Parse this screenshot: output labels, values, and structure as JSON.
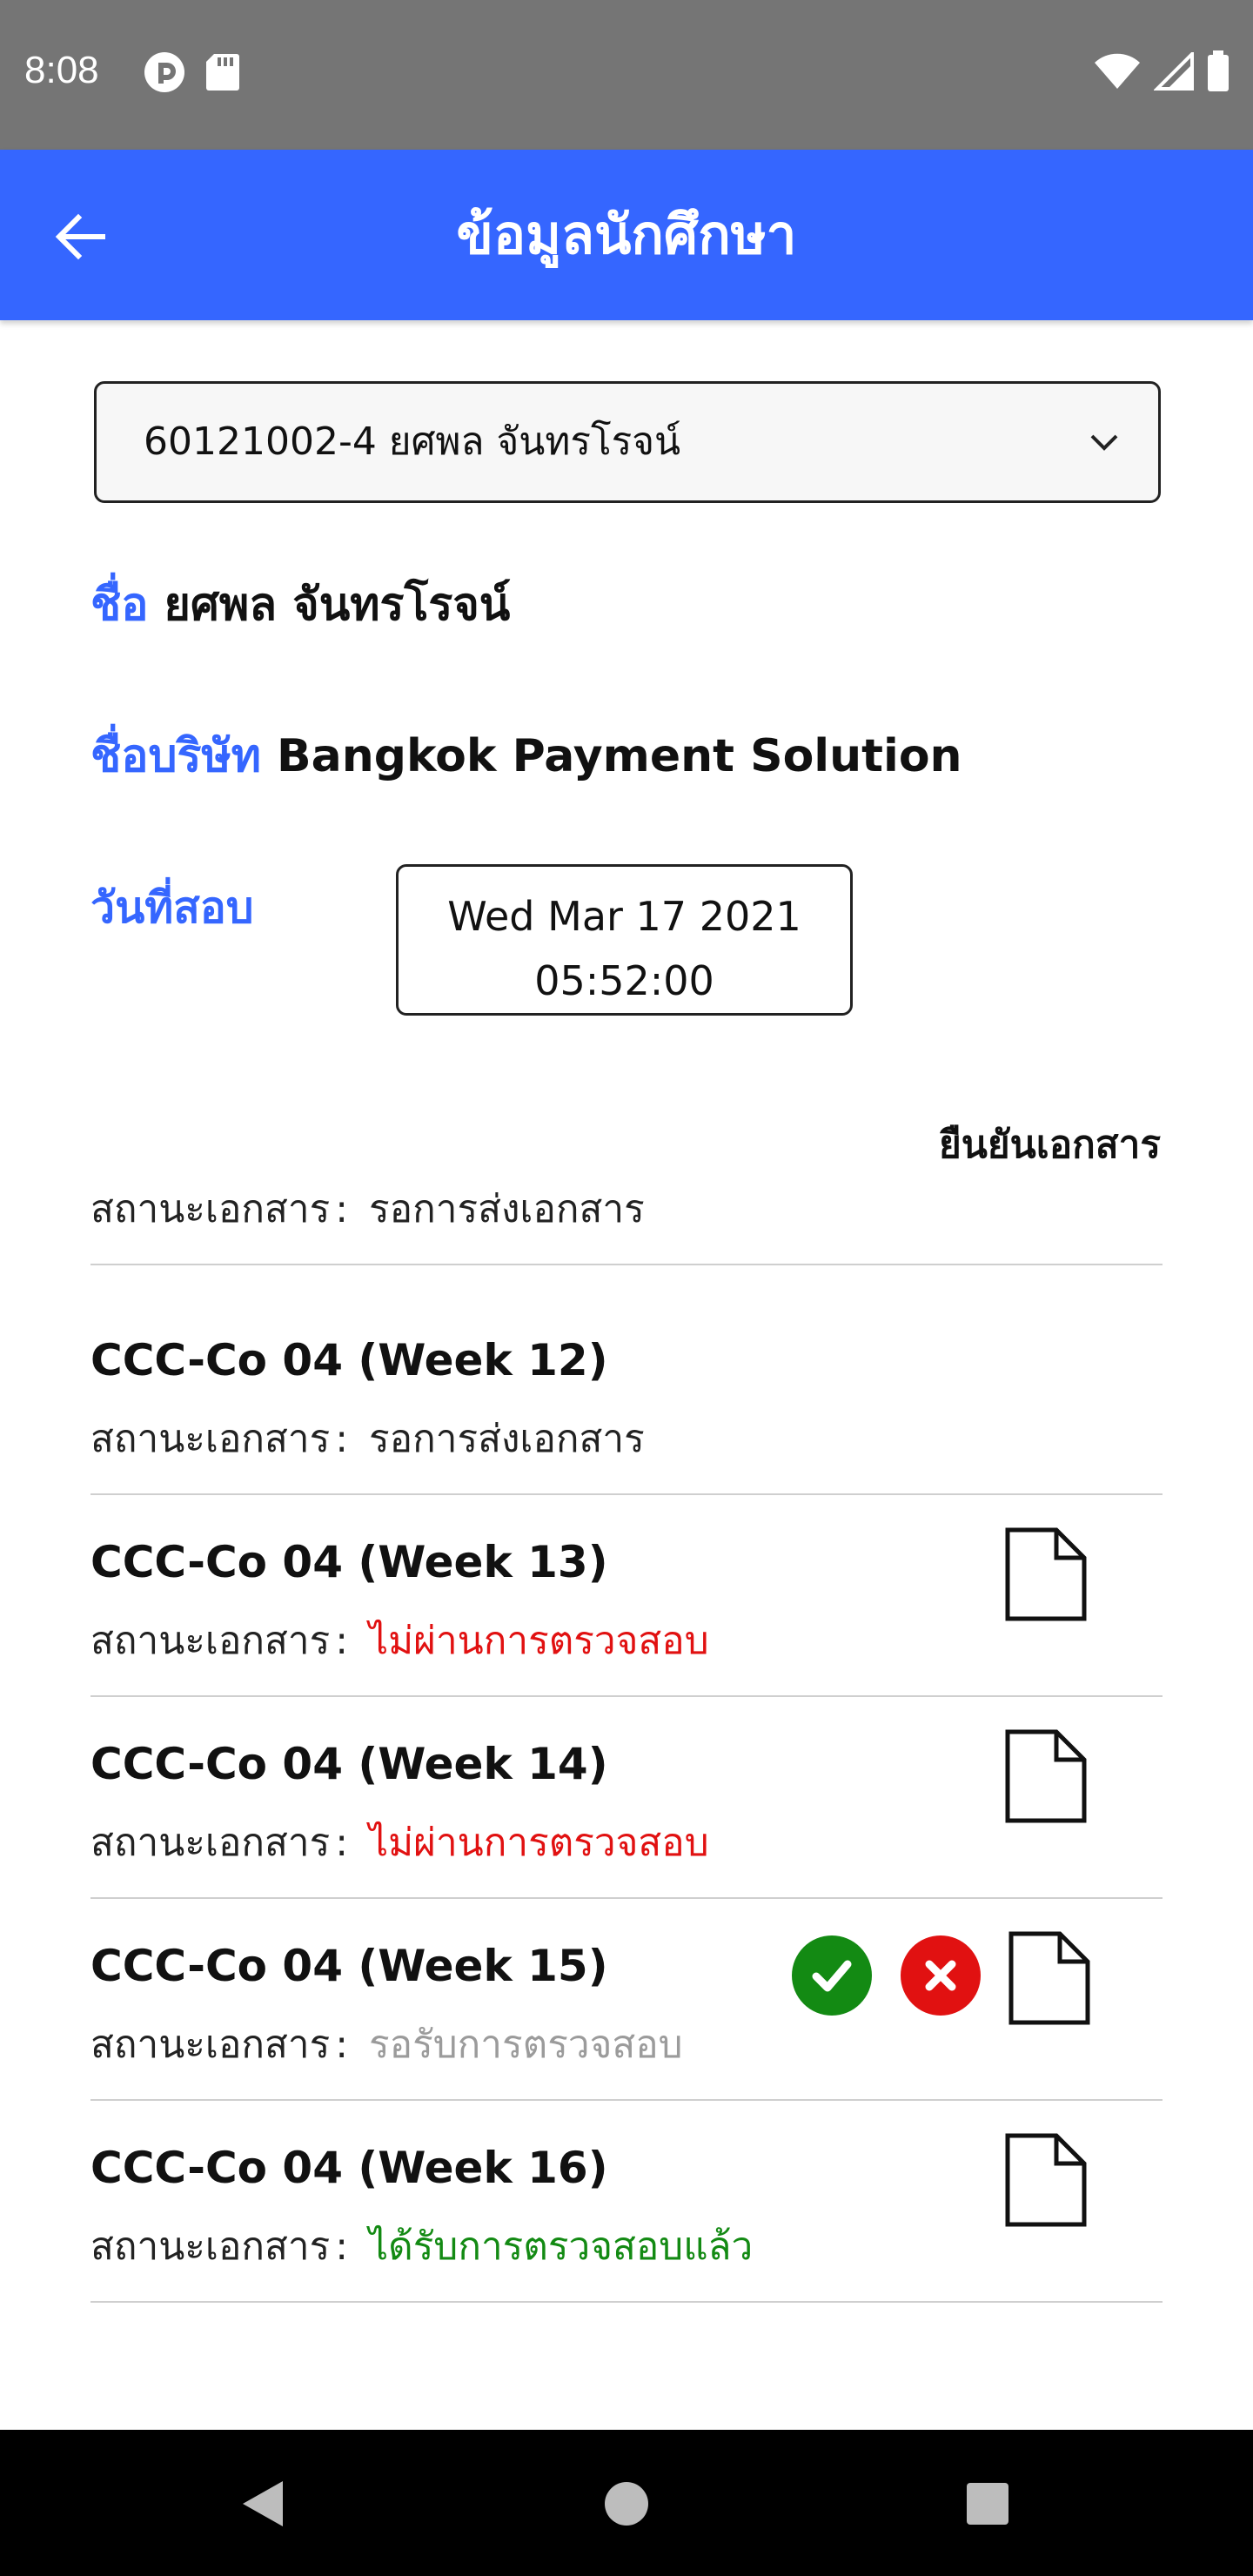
{
  "status_bar": {
    "time": "8:08",
    "icons": [
      "pocket-casts-icon",
      "sd-card-icon",
      "wifi-icon",
      "signal-icon",
      "battery-icon"
    ]
  },
  "app_bar": {
    "title": "ข้อมูลนักศึกษา",
    "back_icon": "arrow-left-icon",
    "color": "#3566ff"
  },
  "student_select": {
    "value": "60121002-4 ยศพล จันทรโรจน์"
  },
  "info": {
    "name_label": "ชื่อ",
    "name_value": "ยศพล จันทรโรจน์",
    "company_label": "ชื่อบริษัท",
    "company_value": "Bangkok Payment Solution",
    "exam_label": "วันที่สอบ",
    "exam_date": "Wed Mar 17 2021",
    "exam_time": "05:52:00"
  },
  "confirm_doc_label": "ยืนยันเอกสาร",
  "documents": [
    {
      "title": "",
      "status_label": "สถานะเอกสาร",
      "status": "รอการส่งเอกสาร",
      "status_type": "wait"
    },
    {
      "title": "CCC-Co 04 (Week 12)",
      "status_label": "สถานะเอกสาร",
      "status": "รอการส่งเอกสาร",
      "status_type": "wait"
    },
    {
      "title": "CCC-Co 04 (Week 13)",
      "status_label": "สถานะเอกสาร",
      "status": "ไม่ผ่านการตรวจสอบ",
      "status_type": "fail"
    },
    {
      "title": "CCC-Co 04 (Week 14)",
      "status_label": "สถานะเอกสาร",
      "status": "ไม่ผ่านการตรวจสอบ",
      "status_type": "fail"
    },
    {
      "title": "CCC-Co 04 (Week 15)",
      "status_label": "สถานะเอกสาร",
      "status": "รอรับการตรวจสอบ",
      "status_type": "pending"
    },
    {
      "title": "CCC-Co 04 (Week 16)",
      "status_label": "สถานะเอกสาร",
      "status": "ได้รับการตรวจสอบแล้ว",
      "status_type": "pass"
    }
  ],
  "colors": {
    "fail": "#e11111",
    "pass": "#138a13",
    "pending": "#9b9b9b"
  }
}
